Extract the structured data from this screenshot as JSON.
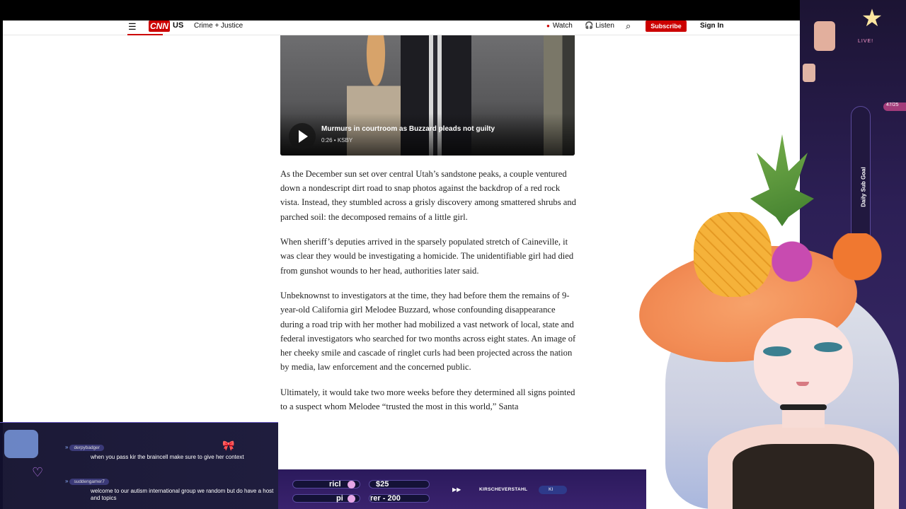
{
  "header": {
    "menu_icon": "hamburger-icon",
    "logo": "CNN",
    "section": "US",
    "sub_section": "Crime + Justice",
    "watch": "Watch",
    "listen": "Listen",
    "search_icon": "search-icon",
    "subscribe": "Subscribe",
    "sign_in": "Sign In",
    "brand_color": "#cc0000"
  },
  "video": {
    "title": "Murmurs in courtroom as Buzzard pleads not guilty",
    "meta": "0:26 • KSBY",
    "play_icon": "play-icon"
  },
  "article": {
    "paragraphs": [
      "As the December sun set over central Utah’s sandstone peaks, a couple ventured down a nondescript dirt road to snap photos against the backdrop of a red rock vista. Instead, they stumbled across a grisly discovery among smattered shrubs and parched soil: the decomposed remains of a little girl.",
      "When sheriff’s deputies arrived in the sparsely populated stretch of Caineville, it was clear they would be investigating a homicide. The unidentifiable girl had died from gunshot wounds to her head, authorities later said.",
      "Unbeknownst to investigators at the time, they had before them the remains of 9-year-old California girl Melodee Buzzard, whose confounding disappearance during a road trip with her mother had mobilized a vast network of local, state and federal investigators who searched for two months across eight states. An image of her cheeky smile and cascade of ringlet curls had been projected across the nation by media, law enforcement and the concerned public.",
      "Ultimately, it would take two more weeks before they determined all signs pointed to a suspect whom Melodee “trusted the most in this world,” Santa"
    ]
  },
  "overlay": {
    "live_label": "LIVE!",
    "goal_label": "Daily Sub Goal",
    "goal_count": "47/25",
    "chat": [
      {
        "user": "derpybadger",
        "text": "when you pass kir the braincell make sure to give her context"
      },
      {
        "user": "suddengamer7",
        "text": "welcome to our autism international group we random but do have a host and topics"
      }
    ],
    "ticker": {
      "left_top": "ricl",
      "left_bottom": "pi",
      "amount": "$25",
      "bottom_text": "rer - 200",
      "credit": "KIRSCHEVERSTAHL",
      "credit2": "KI"
    }
  }
}
